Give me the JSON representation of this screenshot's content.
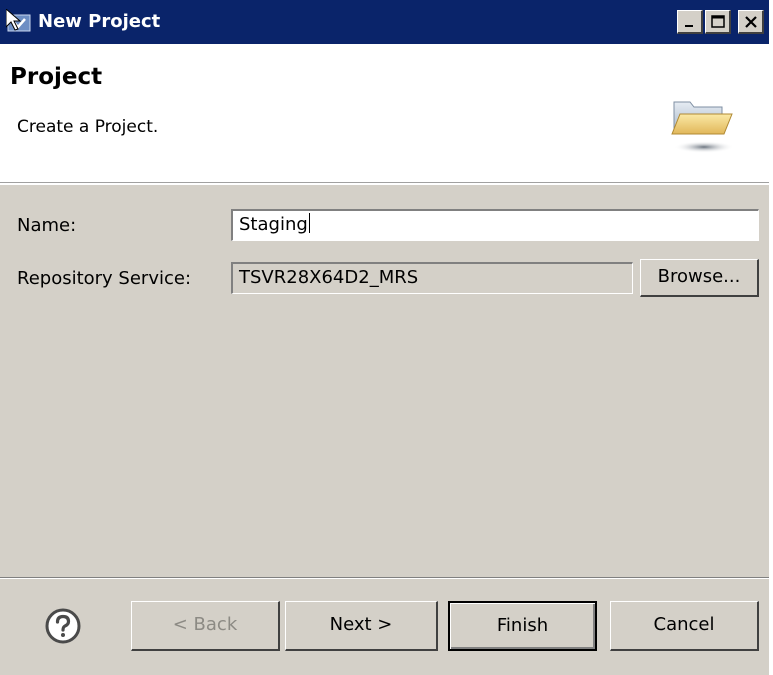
{
  "window": {
    "title": "New Project",
    "controls": {
      "minimize": "minimize",
      "maximize": "maximize",
      "close": "close"
    }
  },
  "header": {
    "title": "Project",
    "description": "Create a Project.",
    "icon": "folder-open-icon"
  },
  "form": {
    "name_label": "Name:",
    "name_value": "Staging",
    "repo_label": "Repository Service:",
    "repo_value": "TSVR28X64D2_MRS",
    "browse_label": "Browse..."
  },
  "footer": {
    "help_icon": "question-circle-icon",
    "back_label": "< Back",
    "next_label": "Next >",
    "finish_label": "Finish",
    "cancel_label": "Cancel"
  },
  "colors": {
    "titlebar": "#0a246a",
    "dialog_bg": "#d4d0c8",
    "header_bg": "#ffffff",
    "disabled_text": "#8c8a84"
  }
}
